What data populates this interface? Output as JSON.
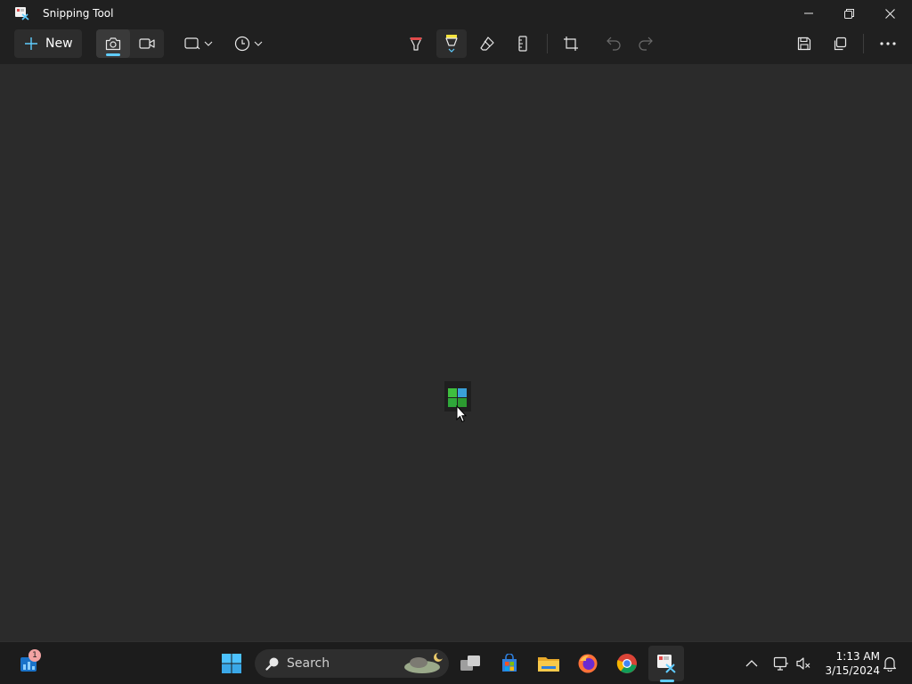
{
  "window": {
    "title": "Snipping Tool",
    "controls": {
      "minimize": "minimize-icon",
      "restore": "restore-icon",
      "close": "close-icon"
    }
  },
  "toolbar": {
    "new_label": "New",
    "mode": {
      "selected": "snip",
      "options": [
        "snip",
        "record"
      ]
    },
    "icons": [
      "rectangle-mode-icon",
      "delay-icon",
      "ballpoint-pen-icon",
      "highlighter-icon",
      "eraser-icon",
      "ruler-icon",
      "crop-icon",
      "undo-icon",
      "redo-icon",
      "save-icon",
      "copy-icon",
      "more-icon"
    ]
  },
  "taskbar": {
    "search_label": "Search",
    "widgets_badge": "1",
    "apps": [
      "start",
      "task-view",
      "microsoft-store",
      "file-explorer",
      "firefox",
      "chrome",
      "snipping-tool"
    ],
    "active_app": "snipping-tool",
    "time": "1:13 AM",
    "date": "3/15/2024"
  },
  "colors": {
    "accent": "#60cdff",
    "app_background": "#2b2b2b",
    "chrome_background": "#202020",
    "taskbar_background": "#1c1c1c"
  }
}
